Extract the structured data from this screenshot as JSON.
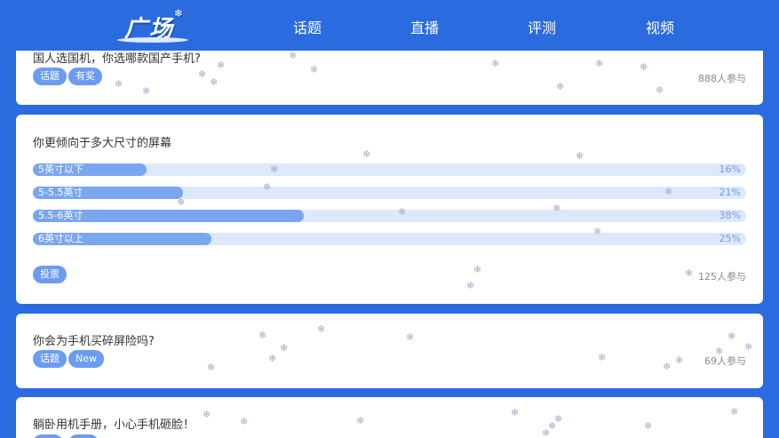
{
  "header": {
    "logo_text": "广场",
    "logo_snow": "❄",
    "nav": [
      "话题",
      "直播",
      "评测",
      "视频"
    ]
  },
  "posts": [
    {
      "title": "国人选国机，你选哪款国产手机?",
      "tags": [
        "话题",
        "有奖"
      ],
      "count": "888人参与"
    },
    {
      "title": "你更倾向于多大尺寸的屏幕",
      "options": [
        {
          "label": "5英寸以下",
          "pct_text": "16%",
          "value": 16
        },
        {
          "label": "5-5.5英寸",
          "pct_text": "21%",
          "value": 21
        },
        {
          "label": "5.5-6英寸",
          "pct_text": "38%",
          "value": 38
        },
        {
          "label": "6英寸以上",
          "pct_text": "25%",
          "value": 25
        }
      ],
      "tags": [
        "投票"
      ],
      "count": "125人参与"
    },
    {
      "title": "你会为手机买碎屏险吗?",
      "tags": [
        "话题",
        "New"
      ],
      "count": "69人参与"
    },
    {
      "title": "躺卧用机手册，小心手机砸脸！",
      "tags": [],
      "count": ""
    }
  ],
  "colors": {
    "background": "#2a6be0",
    "tag": "#6b9cf1",
    "bar_fill": "#7aa6f0",
    "bar_track": "#dde8fb"
  },
  "decor": {
    "snowflake_icon": "❄"
  }
}
